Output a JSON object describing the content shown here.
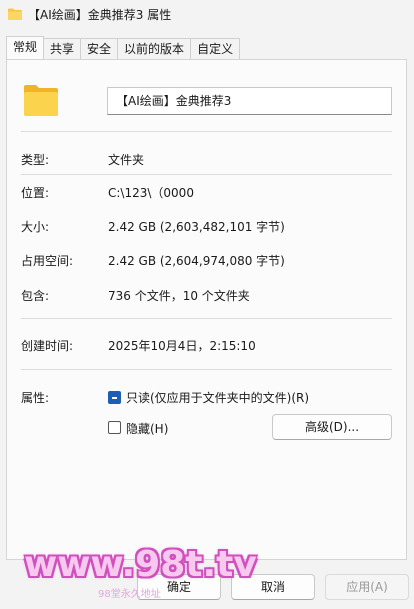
{
  "window": {
    "title": "【AI绘画】金典推荐3 属性"
  },
  "tabs": [
    {
      "label": "常规",
      "active": true
    },
    {
      "label": "共享",
      "active": false
    },
    {
      "label": "安全",
      "active": false
    },
    {
      "label": "以前的版本",
      "active": false
    },
    {
      "label": "自定义",
      "active": false
    }
  ],
  "general": {
    "name_value": "【AI绘画】金典推荐3",
    "type_label": "类型:",
    "type_value": "文件夹",
    "location_label": "位置:",
    "location_value": "C:\\123\\（0000",
    "size_label": "大小:",
    "size_value": "2.42 GB (2,603,482,101 字节)",
    "disk_size_label": "占用空间:",
    "disk_size_value": "2.42 GB (2,604,974,080 字节)",
    "contains_label": "包含:",
    "contains_value": "736 个文件，10 个文件夹",
    "created_label": "创建时间:",
    "created_value": "2025年10月4日，2:15:10",
    "attributes_label": "属性:",
    "readonly_label": "只读(仅应用于文件夹中的文件)(R)",
    "readonly_state": "mixed",
    "hidden_label": "隐藏(H)",
    "hidden_checked": false,
    "advanced_button": "高级(D)..."
  },
  "footer": {
    "ok_button": "确定",
    "cancel_button": "取消",
    "apply_button": "应用(A)",
    "apply_enabled": false
  },
  "watermark": {
    "main": "www.98t.tv",
    "sub": "98堂永久地址"
  },
  "colors": {
    "folder_yellow": "#f8c73e",
    "accent": "#1a5fb4",
    "watermark_pink": "#d14fbe"
  },
  "icons": [
    "folder-icon",
    "folder-large-icon"
  ]
}
